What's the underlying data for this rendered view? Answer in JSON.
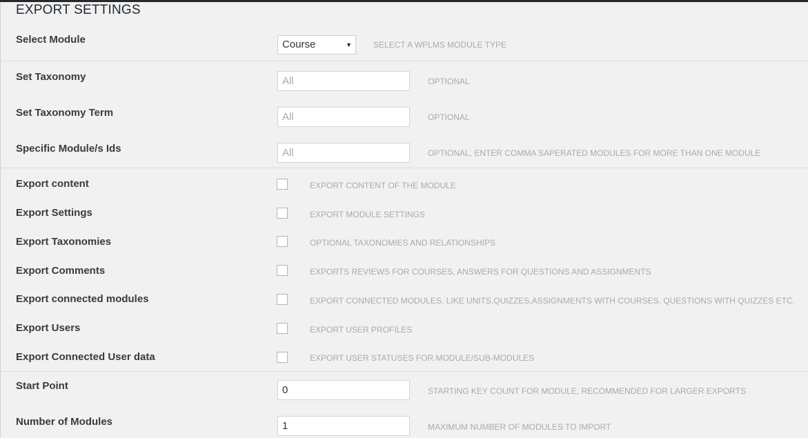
{
  "page": {
    "title": "EXPORT SETTINGS"
  },
  "select_module": {
    "label": "Select Module",
    "value": "Course",
    "description": "SELECT A WPLMS MODULE TYPE"
  },
  "set_taxonomy": {
    "label": "Set Taxonomy",
    "placeholder": "All",
    "description": "OPTIONAL"
  },
  "set_taxonomy_term": {
    "label": "Set Taxonomy Term",
    "placeholder": "All",
    "description": "OPTIONAL"
  },
  "specific_module_ids": {
    "label": "Specific Module/s Ids",
    "placeholder": "All",
    "description": "OPTIONAL, ENTER COMMA SAPERATED MODULES FOR MORE THAN ONE MODULE"
  },
  "export_content": {
    "label": "Export content",
    "checked": false,
    "description": "EXPORT CONTENT OF THE MODULE"
  },
  "export_settings": {
    "label": "Export Settings",
    "checked": false,
    "description": "EXPORT MODULE SETTINGS"
  },
  "export_taxonomies": {
    "label": "Export Taxonomies",
    "checked": false,
    "description": "OPTIONAL TAXONOMIES AND RELATIONSHIPS"
  },
  "export_comments": {
    "label": "Export Comments",
    "checked": false,
    "description": "EXPORTS REVIEWS FOR COURSES, ANSWERS FOR QUESTIONS AND ASSIGNMENTS"
  },
  "export_connected_modules": {
    "label": "Export connected modules",
    "checked": false,
    "description": "EXPORT CONNECTED MODULES, LIKE UNITS,QUIZZES,ASSIGNMENTS WITH COURSES, QUESTIONS WITH QUIZZES ETC."
  },
  "export_users": {
    "label": "Export Users",
    "checked": false,
    "description": "EXPORT USER PROFILES"
  },
  "export_connected_user_data": {
    "label": "Export Connected User data",
    "checked": false,
    "description": "EXPORT USER STATUSES FOR MODULE/SUB-MODULES"
  },
  "start_point": {
    "label": "Start Point",
    "value": "0",
    "description": "STARTING KEY COUNT FOR MODULE, RECOMMENDED FOR LARGER EXPORTS"
  },
  "number_of_modules": {
    "label": "Number of Modules",
    "value": "1",
    "description": "MAXIMUM NUMBER OF MODULES TO IMPORT"
  }
}
